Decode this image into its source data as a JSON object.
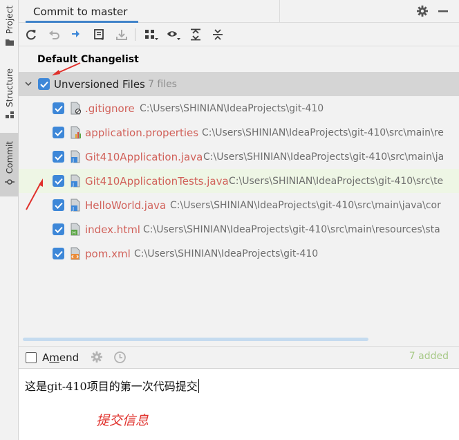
{
  "window": {
    "tab_title": "Commit to master"
  },
  "side_tabs": [
    {
      "label": "Project"
    },
    {
      "label": "Structure"
    },
    {
      "label": "Commit"
    }
  ],
  "changelist": {
    "title": "Default Changelist"
  },
  "group": {
    "label": "Unversioned Files",
    "count": "7 files",
    "checked": true
  },
  "files": [
    {
      "name": ".gitignore",
      "path": "C:\\Users\\SHINIAN\\IdeaProjects\\git-410",
      "icon": "gitignore-file-icon",
      "checked": true
    },
    {
      "name": "application.properties",
      "path": "C:\\Users\\SHINIAN\\IdeaProjects\\git-410\\src\\main\\re",
      "icon": "properties-file-icon",
      "checked": true
    },
    {
      "name": "Git410Application.java",
      "path": "C:\\Users\\SHINIAN\\IdeaProjects\\git-410\\src\\main\\ja",
      "icon": "java-file-icon",
      "checked": true
    },
    {
      "name": "Git410ApplicationTests.java",
      "path": "C:\\Users\\SHINIAN\\IdeaProjects\\git-410\\src\\te",
      "icon": "java-file-icon",
      "checked": true
    },
    {
      "name": "HelloWorld.java",
      "path": "C:\\Users\\SHINIAN\\IdeaProjects\\git-410\\src\\main\\java\\cor",
      "icon": "java-file-icon",
      "checked": true
    },
    {
      "name": "index.html",
      "path": "C:\\Users\\SHINIAN\\IdeaProjects\\git-410\\src\\main\\resources\\sta",
      "icon": "html-file-icon",
      "checked": true
    },
    {
      "name": "pom.xml",
      "path": "C:\\Users\\SHINIAN\\IdeaProjects\\git-410",
      "icon": "xml-file-icon",
      "checked": true
    }
  ],
  "amend": {
    "label_pre": "A",
    "label_underlined": "m",
    "label_post": "end",
    "checked": false,
    "status": "7 added"
  },
  "commit_message": {
    "text": "这是git-410项目的第一次代码提交"
  },
  "annotation": {
    "text": "提交信息"
  },
  "colors": {
    "accent": "#3d87d8",
    "unversioned_file": "#d1615a",
    "added_status": "#a7c987",
    "annotation": "#e0312c"
  }
}
